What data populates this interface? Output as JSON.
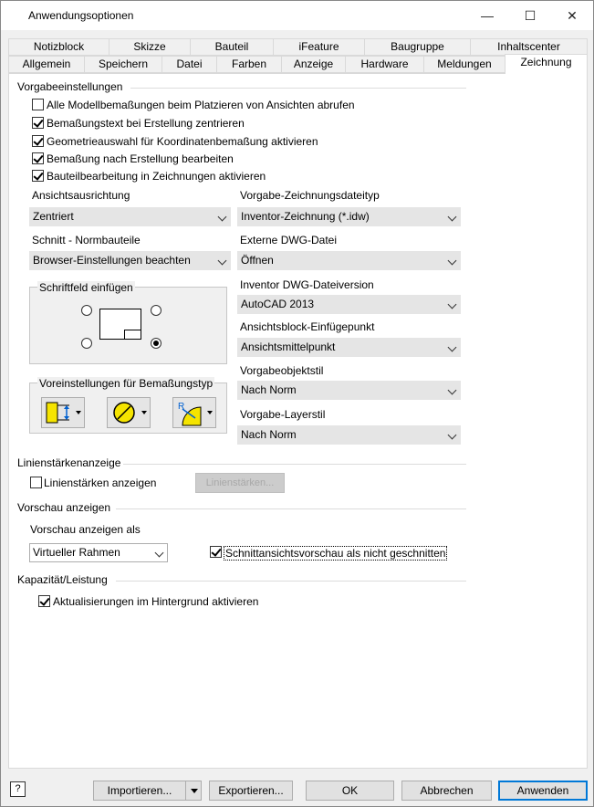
{
  "window": {
    "title": "Anwendungsoptionen",
    "controls": {
      "minimize": "—",
      "maximize": "☐",
      "close": "✕"
    }
  },
  "tabs_row1": [
    "Notizblock",
    "Skizze",
    "Bauteil",
    "iFeature",
    "Baugruppe",
    "Inhaltscenter"
  ],
  "tabs_row2": [
    "Allgemein",
    "Speichern",
    "Datei",
    "Farben",
    "Anzeige",
    "Hardware",
    "Meldungen",
    "Zeichnung"
  ],
  "active_tab": "Zeichnung",
  "defaults": {
    "label": "Vorgabeeinstellungen",
    "checkboxes": [
      {
        "label": "Alle Modellbemaßungen beim Platzieren von Ansichten abrufen",
        "checked": false
      },
      {
        "label": "Bemaßungstext bei Erstellung zentrieren",
        "checked": true
      },
      {
        "label": "Geometrieauswahl für Koordinatenbemaßung aktivieren",
        "checked": true
      },
      {
        "label": "Bemaßung nach Erstellung bearbeiten",
        "checked": true
      },
      {
        "label": "Bauteilbearbeitung in Zeichnungen aktivieren",
        "checked": true
      }
    ],
    "view_alignment": {
      "label": "Ansichtsausrichtung",
      "value": "Zentriert"
    },
    "default_drawing_file_type": {
      "label": "Vorgabe-Zeichnungsdateityp",
      "value": "Inventor-Zeichnung (*.idw)"
    },
    "section_standard_parts": {
      "label": "Schnitt - Normbauteile",
      "value": "Browser-Einstellungen beachten"
    },
    "external_dwg": {
      "label": "Externe DWG-Datei",
      "value": "Öffnen"
    },
    "dwg_version": {
      "label": "Inventor DWG-Dateiversion",
      "value": "AutoCAD 2013"
    },
    "view_block_insertion": {
      "label": "Ansichtsblock-Einfügepunkt",
      "value": "Ansichtsmittelpunkt"
    },
    "default_object_style": {
      "label": "Vorgabeobjektstil",
      "value": "Nach Norm"
    },
    "default_layer_style": {
      "label": "Vorgabe-Layerstil",
      "value": "Nach Norm"
    },
    "title_block": {
      "label": "Schriftfeld einfügen"
    },
    "dimension_presets": {
      "label": "Voreinstellungen für Bemaßungstyp"
    }
  },
  "line_weight": {
    "label": "Linienstärkenanzeige",
    "checkbox": {
      "label": "Linienstärken anzeigen",
      "checked": false
    },
    "button": "Linienstärken..."
  },
  "preview": {
    "label": "Vorschau anzeigen",
    "as_label": "Vorschau anzeigen als",
    "as_value": "Virtueller Rahmen",
    "section_checkbox": {
      "label": "Schnittansichtsvorschau als nicht geschnitten",
      "checked": true
    }
  },
  "capacity": {
    "label": "Kapazität/Leistung",
    "checkbox": {
      "label": "Aktualisierungen im Hintergrund aktivieren",
      "checked": true
    }
  },
  "buttons": {
    "help": "?",
    "import": "Importieren...",
    "export": "Exportieren...",
    "ok": "OK",
    "cancel": "Abbrechen",
    "apply": "Anwenden"
  }
}
